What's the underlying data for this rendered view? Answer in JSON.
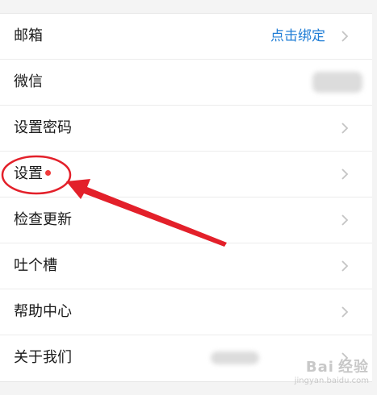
{
  "menu": {
    "items": [
      {
        "label": "邮箱",
        "value": "点击绑定",
        "chevron": "chevron-right-icon"
      },
      {
        "label": "微信",
        "value": "",
        "chevron": ""
      },
      {
        "label": "设置密码",
        "value": "",
        "chevron": "chevron-right-icon"
      },
      {
        "label": "设置",
        "value": "",
        "chevron": "chevron-right-icon",
        "badge": "red-dot"
      },
      {
        "label": "检查更新",
        "value": "",
        "chevron": "chevron-right-icon"
      },
      {
        "label": "吐个槽",
        "value": "",
        "chevron": "chevron-right-icon"
      },
      {
        "label": "帮助中心",
        "value": "",
        "chevron": "chevron-right-icon"
      },
      {
        "label": "关于我们",
        "value": "",
        "chevron": "chevron-right-icon"
      }
    ]
  },
  "colors": {
    "link": "#1f7dd6",
    "annotation": "#e3202a",
    "badge": "#f03a3a"
  },
  "watermark": {
    "main": "Bai",
    "main_cn": "经验",
    "sub": "jingyan.baidu.com"
  }
}
